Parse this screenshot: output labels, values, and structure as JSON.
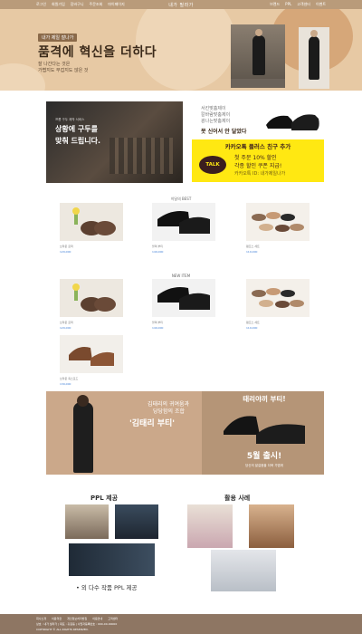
{
  "topbar": {
    "nav_left": [
      "로그인",
      "회원가입",
      "장바구니",
      "주문조회",
      "마이페이지"
    ],
    "logo": "내가 필라가",
    "nav_right": [
      "브랜드",
      "PPL",
      "고객센터",
      "이벤트"
    ]
  },
  "hero": {
    "badge": "내가 제일 잘나가",
    "title": "품격에 혁신을 더하다",
    "sub1": "잘 나간다는 것은",
    "sub2": "가볍지도 무겁지도 않은 것"
  },
  "promo": {
    "tag": "프롬 구두 제작 서비스",
    "headline1": "상황에 구두를",
    "headline2": "맞춰 드립니다."
  },
  "shoe_top": {
    "lines": [
      "서킨맞춤제이",
      "칼바람맞춤제이",
      "광나는맞춤제이"
    ],
    "question": "못 신어서 안 달았다"
  },
  "kakao": {
    "head": "카카오톡 플러스 친구 추가",
    "badge": "TALK",
    "l1": "첫 주문 10% 할인",
    "l2": "각종 할인 쿠폰 지급!",
    "l3": "카카오톡 ID: 내가제일나가"
  },
  "section1": {
    "label": "이달의 BEST"
  },
  "section2": {
    "label": "NEW ITEM"
  },
  "products": {
    "p1": {
      "name": "브라운 로퍼",
      "price": "129,000"
    },
    "p2": {
      "name": "블랙 부티",
      "price": "149,000"
    },
    "p3": {
      "name": "펌프스 세트",
      "price": "119,000"
    },
    "p4": {
      "name": "브라운 로퍼",
      "price": "129,000"
    },
    "p5": {
      "name": "블랙 부티",
      "price": "149,000"
    },
    "p6": {
      "name": "펌프스 세트",
      "price": "119,000"
    },
    "p7": {
      "name": "브라운 옥스포드",
      "price": "139,000"
    }
  },
  "feature": {
    "t1": "김태리의 귀여움과",
    "t1b": "당당함의 조합",
    "t2": "'김태리 부티'",
    "rt1": "태리야끼 부티!",
    "rt2": "5월 출시!",
    "rt3": "당신의 발걸음을 더욱 가볍게"
  },
  "ppl": {
    "title": "PPL 제공",
    "bullet": "• 외 다수 작품 PPL 제공"
  },
  "cases": {
    "title": "활용 사례"
  },
  "footer": {
    "row1": [
      "회사소개",
      "이용약관",
      "개인정보처리방침",
      "이용안내",
      "고객센터"
    ],
    "row2": "상호 : 내가 필라가  |  대표 : 홍길동  |  사업자등록번호 : 000-00-00000",
    "row3": "COPYRIGHT © ALL RIGHTS RESERVED."
  },
  "colors": {
    "accent": "#b99b7a",
    "hero": "#e7c9a4",
    "kakao": "#ffe812"
  }
}
